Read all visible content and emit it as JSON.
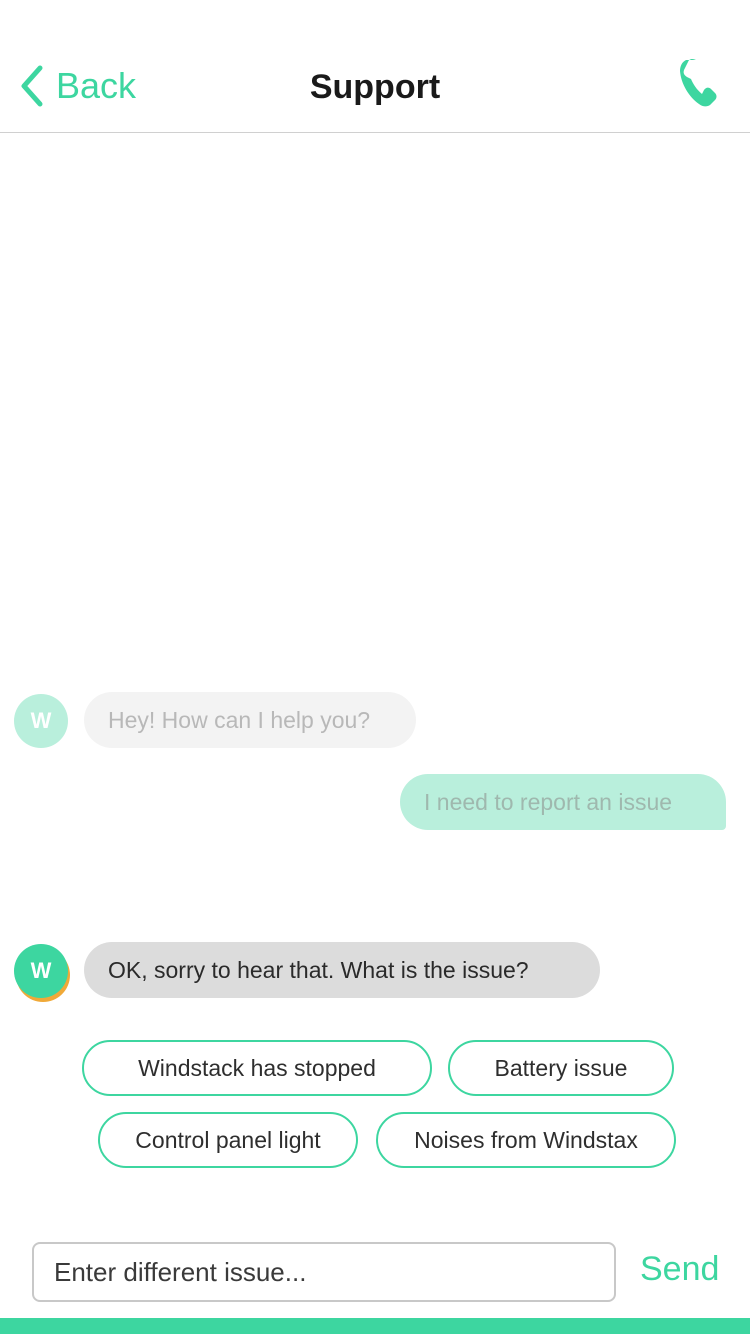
{
  "colors": {
    "accent": "#3dd6a0",
    "accent_light": "#b9efdc",
    "warning_shadow": "#f0a938",
    "bubble_gray": "#dcdcdc",
    "bubble_faded": "#f3f3f3"
  },
  "header": {
    "back_label": "Back",
    "back_icon": "chevron-left-icon",
    "title": "Support",
    "call_icon": "phone-icon"
  },
  "messages": [
    {
      "sender": "bot",
      "avatar_initial": "W",
      "text": "Hey! How can I help you?"
    },
    {
      "sender": "user",
      "text": "I need to report an issue"
    },
    {
      "sender": "bot",
      "avatar_initial": "W",
      "text": "OK, sorry to hear that. What is the issue?"
    }
  ],
  "quick_replies": [
    "Windstack has stopped",
    "Battery issue",
    "Control panel light",
    "Noises from Windstax"
  ],
  "composer": {
    "placeholder": "Enter different issue...",
    "value": "",
    "send_label": "Send"
  }
}
